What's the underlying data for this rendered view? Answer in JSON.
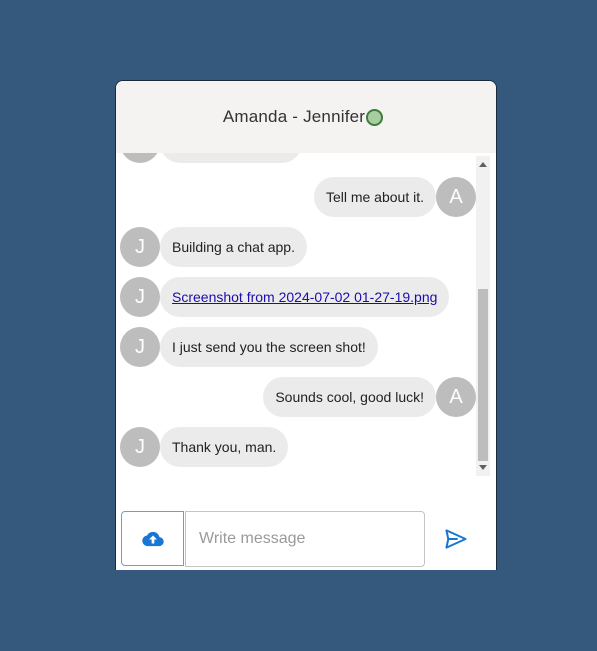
{
  "chat": {
    "title": "Amanda - Jennifer",
    "online_status_color": "#a9cda3"
  },
  "messages": [
    {
      "side": "left",
      "avatar": "J",
      "text": ""
    },
    {
      "side": "right",
      "avatar": "A",
      "text": "Tell me about it."
    },
    {
      "side": "left",
      "avatar": "J",
      "text": "Building a chat app."
    },
    {
      "side": "left",
      "avatar": "J",
      "text": "Screenshot from 2024-07-02 01-27-19.png",
      "is_link": true
    },
    {
      "side": "left",
      "avatar": "J",
      "text": "I just send you the screen shot!"
    },
    {
      "side": "right",
      "avatar": "A",
      "text": "Sounds cool, good luck!"
    },
    {
      "side": "left",
      "avatar": "J",
      "text": "Thank you, man."
    }
  ],
  "composer": {
    "placeholder": "Write message",
    "upload_icon": "cloud-upload-icon",
    "send_icon": "send-icon"
  },
  "colors": {
    "page_background": "#34597d",
    "header_background": "#f5f3f1",
    "bubble_background": "#ebebeb",
    "avatar_background": "#bdbdbd",
    "accent": "#1976d2",
    "link": "#1a0dab"
  }
}
